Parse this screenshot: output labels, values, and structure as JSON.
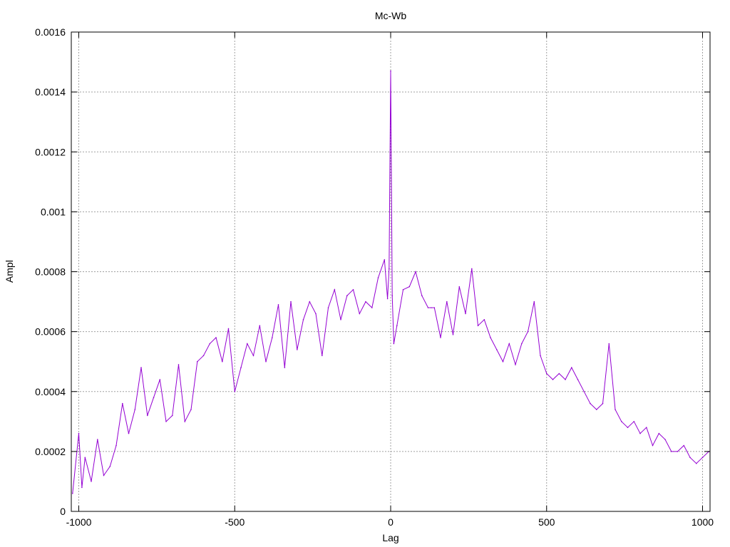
{
  "chart_data": {
    "type": "line",
    "title": "Mc-Wb",
    "xlabel": "Lag",
    "ylabel": "Ampl",
    "xlim": [
      -1024,
      1024
    ],
    "ylim": [
      0,
      0.0016
    ],
    "xticks": [
      -1000,
      -500,
      0,
      500,
      1000
    ],
    "xtick_labels": [
      "-1000",
      "-500",
      "0",
      "500",
      "1000"
    ],
    "yticks": [
      0,
      0.0002,
      0.0004,
      0.0006,
      0.0008,
      0.001,
      0.0012,
      0.0014,
      0.0016
    ],
    "ytick_labels": [
      "0",
      "0.0002",
      "0.0004",
      "0.0006",
      "0.0008",
      "0.001",
      "0.0012",
      "0.0014",
      "0.0016"
    ],
    "grid": true,
    "color": "#9400d3",
    "series": [
      {
        "x": [
          -1020,
          -1000,
          -990,
          -980,
          -960,
          -940,
          -920,
          -900,
          -880,
          -860,
          -840,
          -820,
          -800,
          -780,
          -760,
          -740,
          -720,
          -700,
          -680,
          -660,
          -640,
          -620,
          -600,
          -580,
          -560,
          -540,
          -520,
          -500,
          -480,
          -460,
          -440,
          -420,
          -400,
          -380,
          -360,
          -340,
          -320,
          -300,
          -280,
          -260,
          -240,
          -220,
          -200,
          -180,
          -160,
          -140,
          -120,
          -100,
          -80,
          -60,
          -40,
          -20,
          -10,
          -5,
          0,
          5,
          10,
          20,
          40,
          60,
          80,
          100,
          120,
          130,
          140,
          160,
          180,
          200,
          220,
          240,
          260,
          280,
          300,
          320,
          340,
          360,
          380,
          400,
          420,
          440,
          460,
          480,
          500,
          520,
          540,
          560,
          580,
          600,
          620,
          640,
          660,
          680,
          700,
          720,
          740,
          760,
          780,
          800,
          820,
          840,
          860,
          880,
          900,
          920,
          940,
          960,
          980,
          1000,
          1020
        ],
        "y": [
          6e-05,
          0.00026,
          8e-05,
          0.00018,
          0.0001,
          0.00024,
          0.00012,
          0.00015,
          0.00022,
          0.00036,
          0.00026,
          0.00034,
          0.00048,
          0.00032,
          0.00038,
          0.00044,
          0.0003,
          0.00032,
          0.00049,
          0.0003,
          0.00034,
          0.0005,
          0.00052,
          0.00056,
          0.00058,
          0.0005,
          0.00061,
          0.0004,
          0.00048,
          0.00056,
          0.00052,
          0.00062,
          0.0005,
          0.00058,
          0.00069,
          0.00048,
          0.0007,
          0.00054,
          0.00064,
          0.0007,
          0.00066,
          0.00052,
          0.00068,
          0.00074,
          0.00064,
          0.00072,
          0.00074,
          0.00066,
          0.0007,
          0.00068,
          0.00078,
          0.00084,
          0.00071,
          0.00081,
          0.00147,
          0.00072,
          0.00056,
          0.00062,
          0.00074,
          0.00075,
          0.0008,
          0.00072,
          0.00068,
          0.00068,
          0.00068,
          0.00058,
          0.0007,
          0.00059,
          0.00075,
          0.00066,
          0.00081,
          0.00062,
          0.00064,
          0.00058,
          0.00054,
          0.0005,
          0.00056,
          0.00049,
          0.00056,
          0.0006,
          0.0007,
          0.00052,
          0.00046,
          0.00044,
          0.00046,
          0.00044,
          0.00048,
          0.00044,
          0.0004,
          0.00036,
          0.00034,
          0.00036,
          0.00056,
          0.00034,
          0.0003,
          0.00028,
          0.0003,
          0.00026,
          0.00028,
          0.00022,
          0.00026,
          0.00024,
          0.0002,
          0.0002,
          0.00022,
          0.00018,
          0.00016,
          0.00018,
          0.0002
        ]
      }
    ]
  }
}
